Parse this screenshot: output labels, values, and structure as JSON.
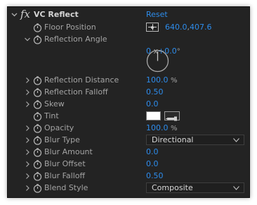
{
  "effect": {
    "title": "VC Reflect",
    "fx_label": "fx",
    "reset_label": "Reset"
  },
  "properties": {
    "floor_position": {
      "label": "Floor Position",
      "x": "640.0",
      "sep": ",",
      "y": "407.6"
    },
    "reflection_angle": {
      "label": "Reflection Angle",
      "revolutions": "0",
      "x_sep": "x",
      "degrees": "+0.0",
      "unit": "°"
    },
    "reflection_distance": {
      "label": "Reflection Distance",
      "value": "100.0",
      "unit": "%"
    },
    "reflection_falloff": {
      "label": "Reflection Falloff",
      "value": "0.50"
    },
    "skew": {
      "label": "Skew",
      "value": "0.0"
    },
    "tint": {
      "label": "Tint",
      "color": "#ffffff"
    },
    "opacity": {
      "label": "Opacity",
      "value": "100.0",
      "unit": "%"
    },
    "blur_type": {
      "label": "Blur Type",
      "selected": "Directional"
    },
    "blur_amount": {
      "label": "Blur Amount",
      "value": "0.0"
    },
    "blur_offset": {
      "label": "Blur Offset",
      "value": "0.0"
    },
    "blur_falloff": {
      "label": "Blur Falloff",
      "value": "0.50"
    },
    "blend_style": {
      "label": "Blend Style",
      "selected": "Composite"
    }
  },
  "colors": {
    "panel_bg": "#232323",
    "value_blue": "#2d8ceb",
    "label_grey": "#a4a4a4"
  },
  "icons": {
    "twirl": "chevron-right-icon",
    "twirl_open": "chevron-down-icon",
    "stopwatch": "stopwatch-icon",
    "position_target": "crosshair-icon",
    "eyedropper": "eyedropper-icon"
  }
}
